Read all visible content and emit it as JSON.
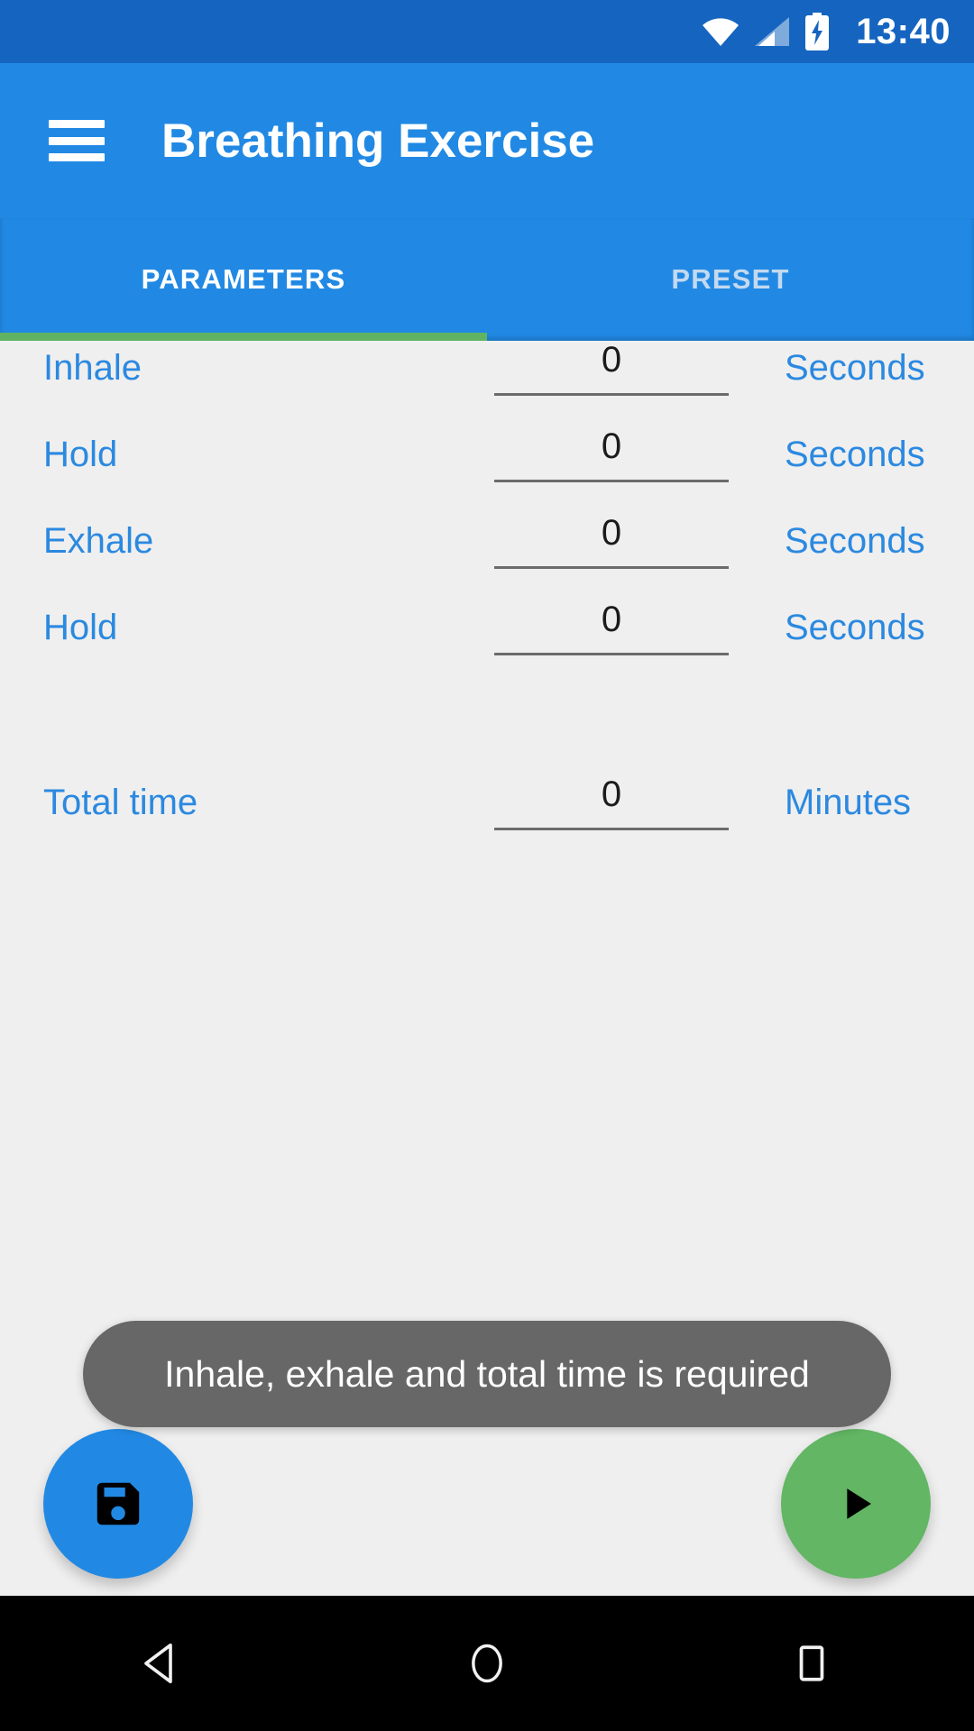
{
  "status_bar": {
    "time": "13:40",
    "icons": [
      "wifi-icon",
      "cellular-signal-icon",
      "battery-charging-icon"
    ],
    "background": "#1565C0"
  },
  "app_bar": {
    "menu_icon": "hamburger-menu-icon",
    "title": "Breathing Exercise",
    "background": "#2189E4"
  },
  "tabs": {
    "items": [
      {
        "label": "PARAMETERS",
        "active": true
      },
      {
        "label": "PRESET",
        "active": false
      }
    ],
    "indicator_color": "#60B362",
    "active_color": "#FFFFFF",
    "inactive_color": "#C3D9EF"
  },
  "parameters": {
    "label_color": "#2B89E0",
    "rows": [
      {
        "label": "Inhale",
        "value": "0",
        "unit": "Seconds"
      },
      {
        "label": "Hold",
        "value": "0",
        "unit": "Seconds"
      },
      {
        "label": "Exhale",
        "value": "0",
        "unit": "Seconds"
      },
      {
        "label": "Hold",
        "value": "0",
        "unit": "Seconds"
      },
      {
        "label": "Total time",
        "value": "0",
        "unit": "Minutes"
      }
    ]
  },
  "toast": {
    "message": "Inhale, exhale and total time is required",
    "background": "#616161",
    "text_color": "#FFFFFF"
  },
  "actions": {
    "save": {
      "icon": "save-floppy-disk-icon",
      "color": "#2189E4"
    },
    "play": {
      "icon": "play-triangle-icon",
      "color": "#62B664"
    }
  },
  "nav_bar": {
    "buttons": [
      {
        "name": "back-button",
        "icon": "back-triangle-icon"
      },
      {
        "name": "home-button",
        "icon": "home-circle-icon"
      },
      {
        "name": "recents-button",
        "icon": "recents-square-icon"
      }
    ],
    "background": "#000000"
  }
}
